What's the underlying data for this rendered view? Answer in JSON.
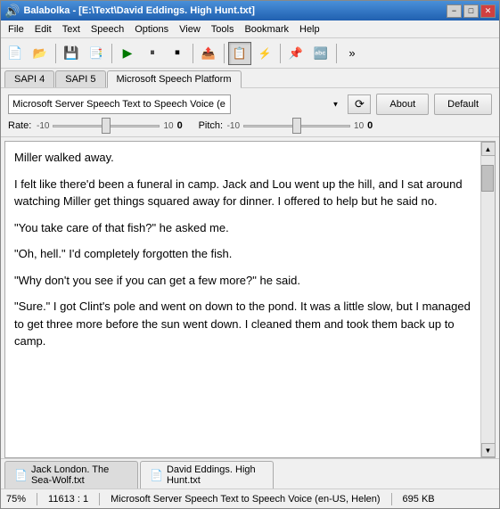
{
  "titlebar": {
    "title": "Balabolka - [E:\\Text\\David Eddings. High Hunt.txt]",
    "icon": "🔊",
    "minimize_label": "−",
    "maximize_label": "□",
    "close_label": "✕"
  },
  "menubar": {
    "items": [
      "File",
      "Edit",
      "Text",
      "Speech",
      "Options",
      "View",
      "Tools",
      "Bookmark",
      "Help"
    ]
  },
  "toolbar": {
    "buttons": [
      {
        "name": "new",
        "icon": "📄"
      },
      {
        "name": "open",
        "icon": "📂"
      },
      {
        "name": "sep1",
        "type": "sep"
      },
      {
        "name": "save",
        "icon": "💾"
      },
      {
        "name": "saveas",
        "icon": "📋"
      },
      {
        "name": "sep2",
        "type": "sep"
      },
      {
        "name": "play",
        "icon": "▶"
      },
      {
        "name": "pause",
        "icon": "⏸"
      },
      {
        "name": "stop",
        "icon": "⏹"
      },
      {
        "name": "sep3",
        "type": "sep"
      },
      {
        "name": "export",
        "icon": "📤"
      },
      {
        "name": "sep4",
        "type": "sep"
      },
      {
        "name": "active-btn",
        "icon": "📑",
        "active": true
      },
      {
        "name": "split",
        "icon": "⚡"
      },
      {
        "name": "sep5",
        "type": "sep"
      },
      {
        "name": "clip1",
        "icon": "📌"
      },
      {
        "name": "clip2",
        "icon": "🔤"
      },
      {
        "name": "sep6",
        "type": "sep"
      },
      {
        "name": "more",
        "icon": "»"
      }
    ]
  },
  "tts_tabs": {
    "tabs": [
      "SAPI 4",
      "SAPI 5",
      "Microsoft Speech Platform"
    ],
    "active": 2
  },
  "voice_panel": {
    "voice_name": "Microsoft Server Speech Text to Speech Voice (e",
    "refresh_label": "⟳",
    "about_label": "About",
    "default_label": "Default",
    "rate_label": "Rate:",
    "rate_value": "0",
    "rate_min": "-10",
    "rate_max": "10",
    "pitch_label": "Pitch:",
    "pitch_value": "0",
    "pitch_min": "-10",
    "pitch_max": "10"
  },
  "text_content": {
    "paragraphs": [
      "Miller walked away.",
      "I felt like there'd been a funeral in camp. Jack and Lou went up the hill, and I sat around watching Miller get things squared away for dinner. I offered to help but he said no.",
      "\"You take care of that fish?\" he asked me.",
      "\"Oh, hell.\" I'd completely forgotten the fish.",
      "\"Why don't you see if you can get a few more?\" he said.",
      "\"Sure.\" I got Clint's pole and went on down to the pond. It was a little slow, but I managed to get three more before the sun went down. I cleaned them and took them back up to camp."
    ]
  },
  "file_tabs": {
    "tabs": [
      {
        "name": "Jack London. The Sea-Wolf.txt",
        "active": false
      },
      {
        "name": "David Eddings. High Hunt.txt",
        "active": true
      }
    ]
  },
  "statusbar": {
    "zoom": "75%",
    "position": "11613 : 1",
    "voice": "Microsoft Server Speech Text to Speech Voice (en-US, Helen)",
    "size": "695 KB"
  }
}
